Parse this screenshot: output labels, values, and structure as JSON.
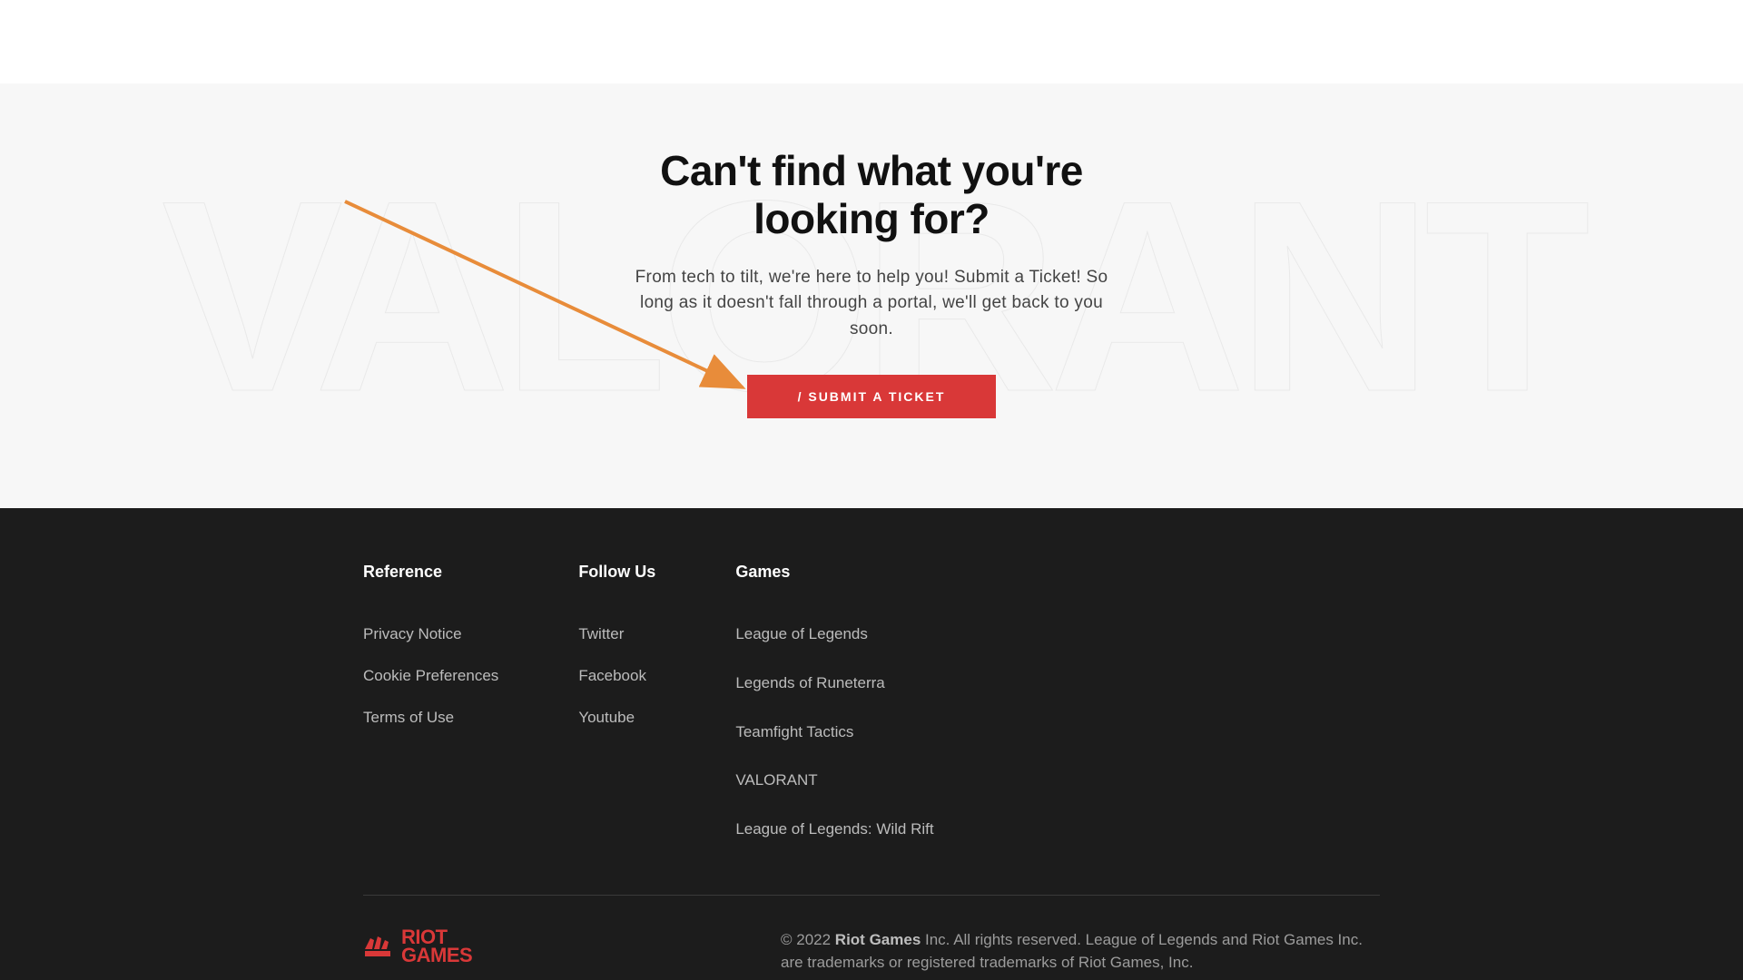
{
  "hero": {
    "bg_text": "VALORANT",
    "title": "Can't find what you're looking for?",
    "subtitle": "From tech to tilt, we're here to help you! Submit a Ticket! So long as it doesn't fall through a portal, we'll get back to you soon.",
    "button_label": "/ SUBMIT A TICKET"
  },
  "footer": {
    "columns": [
      {
        "title": "Reference",
        "links": [
          "Privacy Notice",
          "Cookie Preferences",
          "Terms of Use"
        ]
      },
      {
        "title": "Follow Us",
        "links": [
          "Twitter",
          "Facebook",
          "Youtube"
        ]
      },
      {
        "title": "Games",
        "links": [
          "League of Legends",
          "Legends of Runeterra",
          "Teamfight Tactics",
          "VALORANT",
          "League of Legends: Wild Rift"
        ]
      }
    ],
    "logo_line1": "RIOT",
    "logo_line2": "GAMES",
    "copyright_prefix": "© 2022 ",
    "copyright_brand": "Riot Games",
    "copyright_suffix": " Inc. All rights reserved. League of Legends and Riot Games Inc. are trademarks or registered trademarks of Riot Games, Inc."
  }
}
